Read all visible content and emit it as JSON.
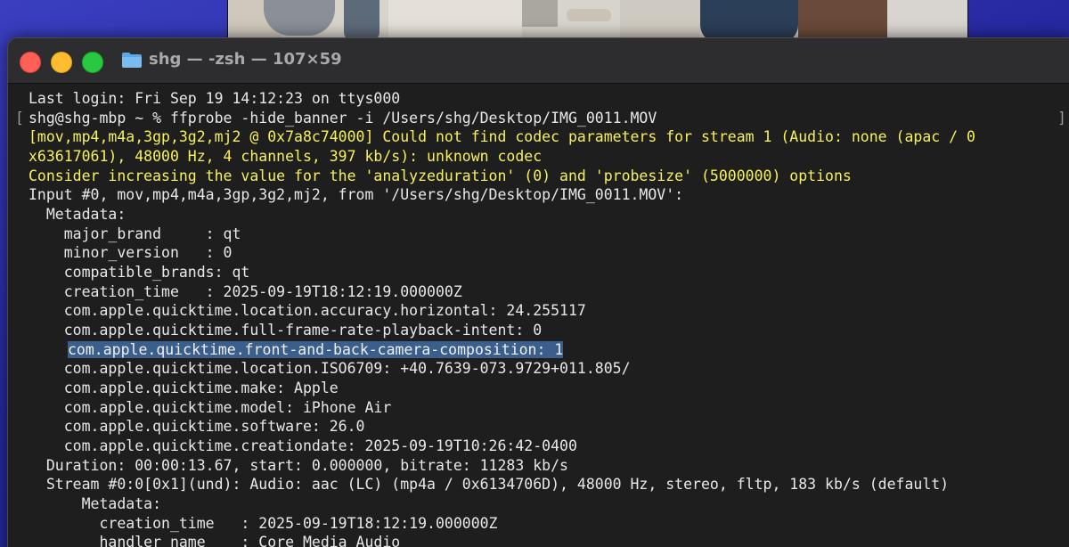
{
  "window": {
    "title": "shg — -zsh — 107×59"
  },
  "terminal": {
    "lines": [
      "Last login: Fri Sep 19 14:12:23 on ttys000",
      "shg@shg-mbp ~ % ffprobe -hide_banner -i /Users/shg/Desktop/IMG_0011.MOV",
      "[mov,mp4,m4a,3gp,3g2,mj2 @ 0x7a8c74000] Could not find codec parameters for stream 1 (Audio: none (apac / 0",
      "x63617061), 48000 Hz, 4 channels, 397 kb/s): unknown codec",
      "Consider increasing the value for the 'analyzeduration' (0) and 'probesize' (5000000) options",
      "Input #0, mov,mp4,m4a,3gp,3g2,mj2, from '/Users/shg/Desktop/IMG_0011.MOV':",
      "  Metadata:",
      "    major_brand     : qt",
      "    minor_version   : 0",
      "    compatible_brands: qt",
      "    creation_time   : 2025-09-19T18:12:19.000000Z",
      "    com.apple.quicktime.location.accuracy.horizontal: 24.255117",
      "    com.apple.quicktime.full-frame-rate-playback-intent: 0",
      "com.apple.quicktime.front-and-back-camera-composition: 1",
      "    com.apple.quicktime.location.ISO6709: +40.7639-073.9729+011.805/",
      "    com.apple.quicktime.make: Apple",
      "    com.apple.quicktime.model: iPhone Air",
      "    com.apple.quicktime.software: 26.0",
      "    com.apple.quicktime.creationdate: 2025-09-19T10:26:42-0400",
      "  Duration: 00:00:13.67, start: 0.000000, bitrate: 11283 kb/s",
      "  Stream #0:0[0x1](und): Audio: aac (LC) (mp4a / 0x6134706D), 48000 Hz, stereo, fltp, 183 kb/s (default)",
      "      Metadata:",
      "        creation_time   : 2025-09-19T18:12:19.000000Z",
      "        handler_name    : Core Media Audio"
    ]
  },
  "colors": {
    "warning_text": "#f7f15a",
    "selection": "#3a5f8c",
    "close": "#ff5f57",
    "minimize": "#febc2e",
    "maximize": "#28c840"
  },
  "icons": {
    "folder": "folder-icon"
  }
}
